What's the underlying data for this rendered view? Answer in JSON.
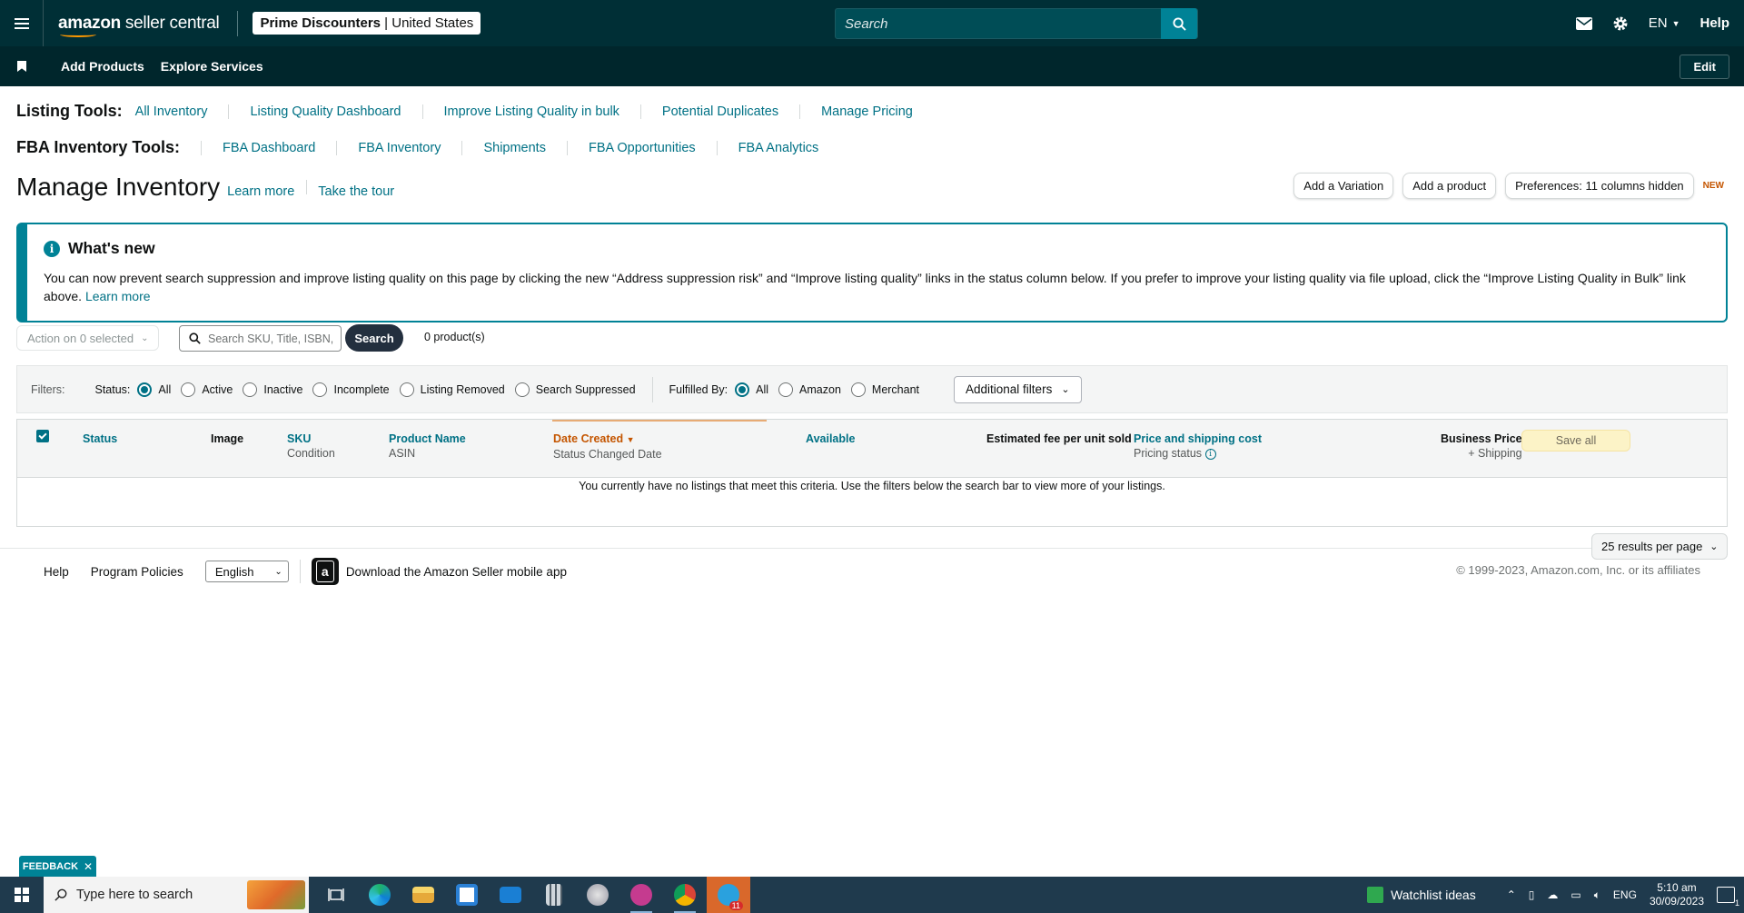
{
  "topnav": {
    "logo_bold": "amazon",
    "logo_rest": " seller central",
    "account_name": "Prime Discounters",
    "account_sep": " | ",
    "account_region": "United States",
    "search_placeholder": "Search",
    "lang": "EN",
    "help": "Help"
  },
  "subnav": {
    "items": [
      "Add Products",
      "Explore Services"
    ],
    "edit": "Edit"
  },
  "listing_tools": {
    "label": "Listing Tools:",
    "links": [
      "All Inventory",
      "Listing Quality Dashboard",
      "Improve Listing Quality in bulk",
      "Potential Duplicates",
      "Manage Pricing"
    ]
  },
  "fba_tools": {
    "label": "FBA Inventory Tools:",
    "links": [
      "FBA Dashboard",
      "FBA Inventory",
      "Shipments",
      "FBA Opportunities",
      "FBA Analytics"
    ]
  },
  "page": {
    "title": "Manage Inventory",
    "learn_more": "Learn more",
    "take_tour": "Take the tour",
    "btn_add_variation": "Add a Variation",
    "btn_add_product": "Add a product",
    "btn_preferences": "Preferences: 11 columns hidden",
    "new_tag": "NEW"
  },
  "whats_new": {
    "title": "What's new",
    "body": "You can now prevent search suppression and improve listing quality on this page by clicking the new “Address suppression risk” and “Improve listing quality” links in the status column below. If you prefer to improve your listing quality via file upload, click the “Improve Listing Quality in Bulk” link above.",
    "learn_more": "Learn more"
  },
  "actions": {
    "action_select": "Action on 0 selected",
    "sku_placeholder": "Search SKU, Title, ISBN,",
    "search_btn": "Search",
    "product_count": "0 product(s)"
  },
  "filters": {
    "label": "Filters:",
    "status_label": "Status:",
    "status_options": [
      "All",
      "Active",
      "Inactive",
      "Incomplete",
      "Listing Removed",
      "Search Suppressed"
    ],
    "status_selected": "All",
    "fulfilled_label": "Fulfilled By:",
    "fulfilled_options": [
      "All",
      "Amazon",
      "Merchant"
    ],
    "fulfilled_selected": "All",
    "additional": "Additional filters"
  },
  "table": {
    "col_status": "Status",
    "col_image": "Image",
    "col_sku": "SKU",
    "col_sku_sub": "Condition",
    "col_product": "Product Name",
    "col_product_sub": "ASIN",
    "col_date": "Date Created",
    "col_date_sub": "Status Changed Date",
    "col_available": "Available",
    "col_fee": "Estimated fee per unit sold",
    "col_price": "Price and shipping cost",
    "col_price_sub": "Pricing status",
    "col_business": "Business Price",
    "col_business_sub": "+ Shipping",
    "save_all": "Save all",
    "empty_message": "You currently have no listings that meet this criteria. Use the filters below the search bar to view more of your listings."
  },
  "pagination": {
    "per_page": "25 results per page"
  },
  "footer": {
    "help": "Help",
    "policies": "Program Policies",
    "language": "English",
    "app": "Download the Amazon Seller mobile app",
    "copyright": "© 1999-2023, Amazon.com, Inc. or its affiliates"
  },
  "feedback": "FEEDBACK",
  "taskbar": {
    "search_placeholder": "Type here to search",
    "watchlist": "Watchlist ideas",
    "lang": "ENG",
    "time": "5:10 am",
    "date": "30/09/2023",
    "badge": "11",
    "notif_count": "1"
  },
  "colors": {
    "teal_dark": "#002f36",
    "teal": "#008296",
    "link": "#007185",
    "orange": "#c45500"
  }
}
